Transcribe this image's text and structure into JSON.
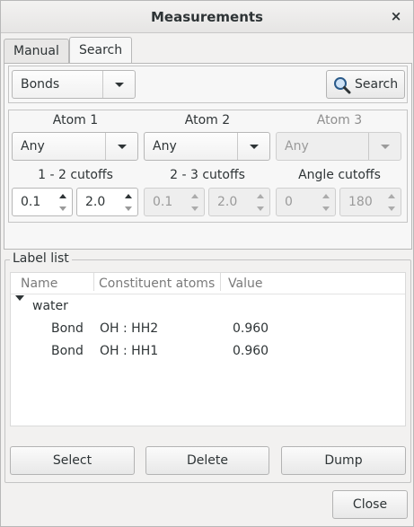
{
  "window": {
    "title": "Measurements",
    "close_glyph": "×"
  },
  "tabs": [
    {
      "label": "Manual"
    },
    {
      "label": "Search"
    }
  ],
  "search": {
    "type_combo": "Bonds",
    "search_button": "Search",
    "atoms": [
      {
        "label": "Atom 1",
        "value": "Any"
      },
      {
        "label": "Atom 2",
        "value": "Any"
      },
      {
        "label": "Atom 3",
        "value": "Any"
      }
    ],
    "cutoffs": [
      {
        "label": "1 - 2 cutoffs",
        "min": "0.1",
        "max": "2.0"
      },
      {
        "label": "2 - 3 cutoffs",
        "min": "0.1",
        "max": "2.0"
      },
      {
        "label": "Angle cutoffs",
        "min": "0",
        "max": "180"
      }
    ]
  },
  "label_list": {
    "title": "Label list",
    "columns": [
      "Name",
      "Constituent atoms",
      "Value"
    ],
    "group": "water",
    "rows": [
      {
        "name": "Bond",
        "atoms": "OH : HH2",
        "value": "0.960"
      },
      {
        "name": "Bond",
        "atoms": "OH : HH1",
        "value": "0.960"
      }
    ],
    "buttons": {
      "select": "Select",
      "delete": "Delete",
      "dump": "Dump"
    }
  },
  "footer": {
    "close": "Close"
  },
  "icons": {
    "search": "magnifier-icon",
    "close": "close-icon"
  }
}
